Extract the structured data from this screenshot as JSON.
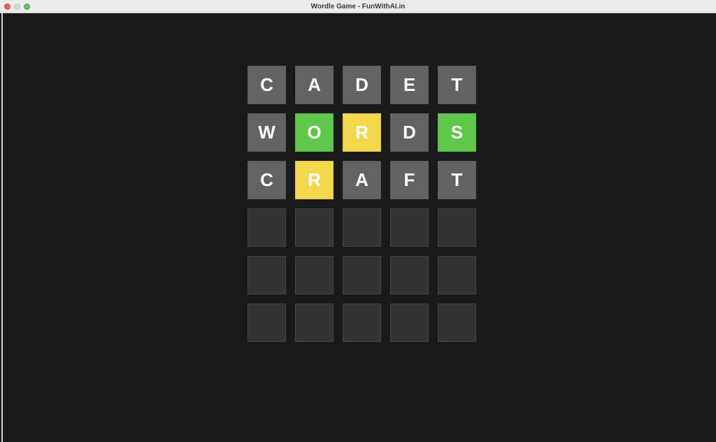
{
  "window": {
    "title": "Wordle Game - FunWithAI.in"
  },
  "colors": {
    "background": "#1a1a1a",
    "absent": "#636363",
    "correct": "#5fc84a",
    "present": "#f4d84b",
    "empty": "#333333"
  },
  "board": {
    "rows": [
      [
        {
          "letter": "C",
          "state": "absent"
        },
        {
          "letter": "A",
          "state": "absent"
        },
        {
          "letter": "D",
          "state": "absent"
        },
        {
          "letter": "E",
          "state": "absent"
        },
        {
          "letter": "T",
          "state": "absent"
        }
      ],
      [
        {
          "letter": "W",
          "state": "absent"
        },
        {
          "letter": "O",
          "state": "correct"
        },
        {
          "letter": "R",
          "state": "present"
        },
        {
          "letter": "D",
          "state": "absent"
        },
        {
          "letter": "S",
          "state": "correct"
        }
      ],
      [
        {
          "letter": "C",
          "state": "absent"
        },
        {
          "letter": "R",
          "state": "present"
        },
        {
          "letter": "A",
          "state": "absent"
        },
        {
          "letter": "F",
          "state": "absent"
        },
        {
          "letter": "T",
          "state": "absent"
        }
      ],
      [
        {
          "letter": "",
          "state": "empty"
        },
        {
          "letter": "",
          "state": "empty"
        },
        {
          "letter": "",
          "state": "empty"
        },
        {
          "letter": "",
          "state": "empty"
        },
        {
          "letter": "",
          "state": "empty"
        }
      ],
      [
        {
          "letter": "",
          "state": "empty"
        },
        {
          "letter": "",
          "state": "empty"
        },
        {
          "letter": "",
          "state": "empty"
        },
        {
          "letter": "",
          "state": "empty"
        },
        {
          "letter": "",
          "state": "empty"
        }
      ],
      [
        {
          "letter": "",
          "state": "empty"
        },
        {
          "letter": "",
          "state": "empty"
        },
        {
          "letter": "",
          "state": "empty"
        },
        {
          "letter": "",
          "state": "empty"
        },
        {
          "letter": "",
          "state": "empty"
        }
      ]
    ]
  }
}
